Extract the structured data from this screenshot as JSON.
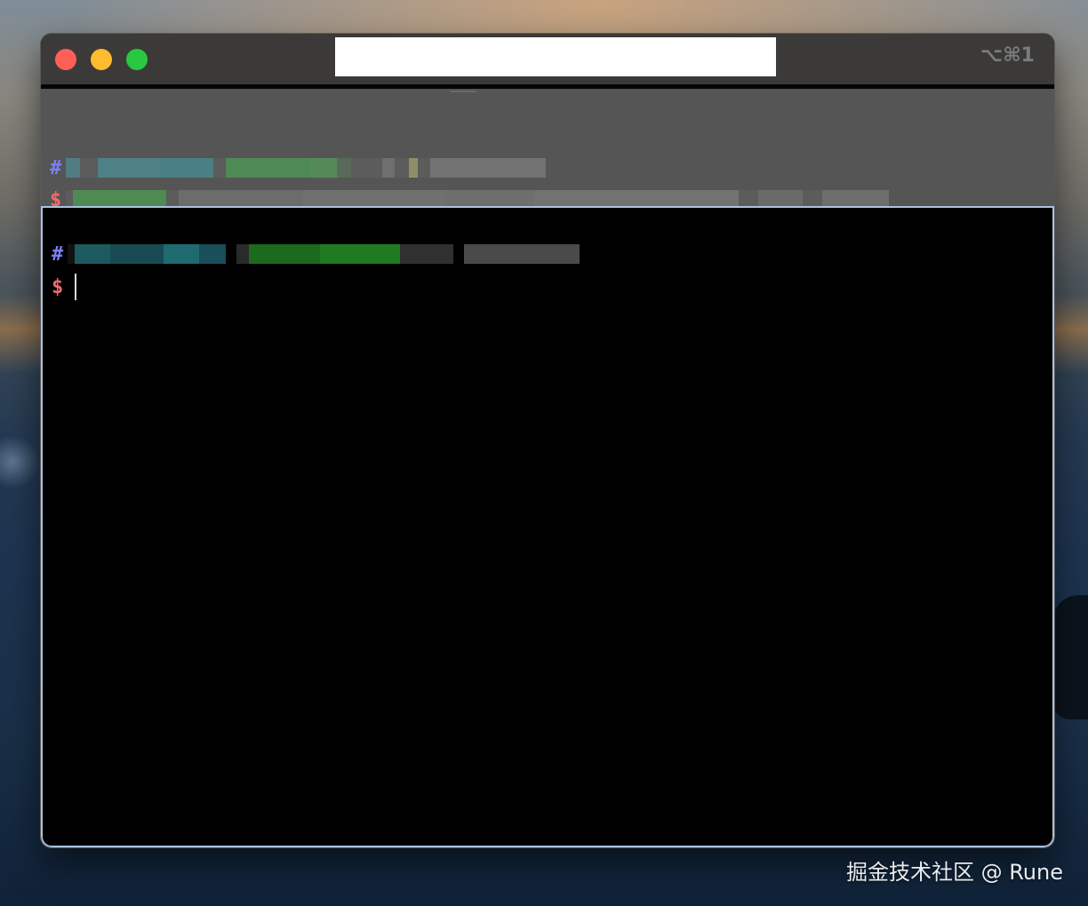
{
  "window": {
    "title": "",
    "shortcut": "⌥⌘1"
  },
  "top_pane": {
    "comment_prompt": "#",
    "command_prompt": "$"
  },
  "bottom_pane": {
    "comment_prompt": "#",
    "command_prompt": "$"
  },
  "watermark": "掘金技术社区 @ Rune",
  "colors": {
    "close": "#ff5f57",
    "minimize": "#febc2e",
    "maximize": "#28c840",
    "prompt_hash": "#7a7ff0",
    "prompt_dollar": "#f06b6b",
    "active_pane_border": "#a9c2dd"
  }
}
